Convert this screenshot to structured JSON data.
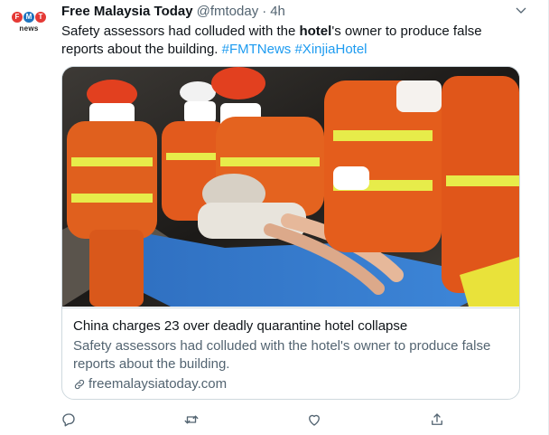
{
  "tweet": {
    "display_name": "Free Malaysia Today",
    "handle": "@fmtoday",
    "separator": "·",
    "time": "4h",
    "text": {
      "part1": "Safety assessors had colluded with the ",
      "bold": "hotel",
      "part2": "'s owner to produce false reports about the building. ",
      "hashtag1": "#FMTNews",
      "space": " ",
      "hashtag2": "#XinjiaHotel"
    }
  },
  "avatar": {
    "letters": [
      "F",
      "M",
      "T"
    ],
    "news_label": "news",
    "colors": [
      "#e53935",
      "#1e73be",
      "#e53935"
    ]
  },
  "card": {
    "title": "China charges 23 over deadly quarantine hotel collapse",
    "description": "Safety assessors had colluded with the hotel's owner to produce false reports about the building.",
    "domain": "freemalaysiatoday.com"
  },
  "icons": {
    "more": "chevron-down-icon",
    "reply": "reply-icon",
    "retweet": "retweet-icon",
    "like": "heart-icon",
    "share": "share-icon",
    "link": "link-icon"
  },
  "colors": {
    "link": "#1d9bf0",
    "secondary_text": "#536471",
    "border": "#cfd9de"
  }
}
